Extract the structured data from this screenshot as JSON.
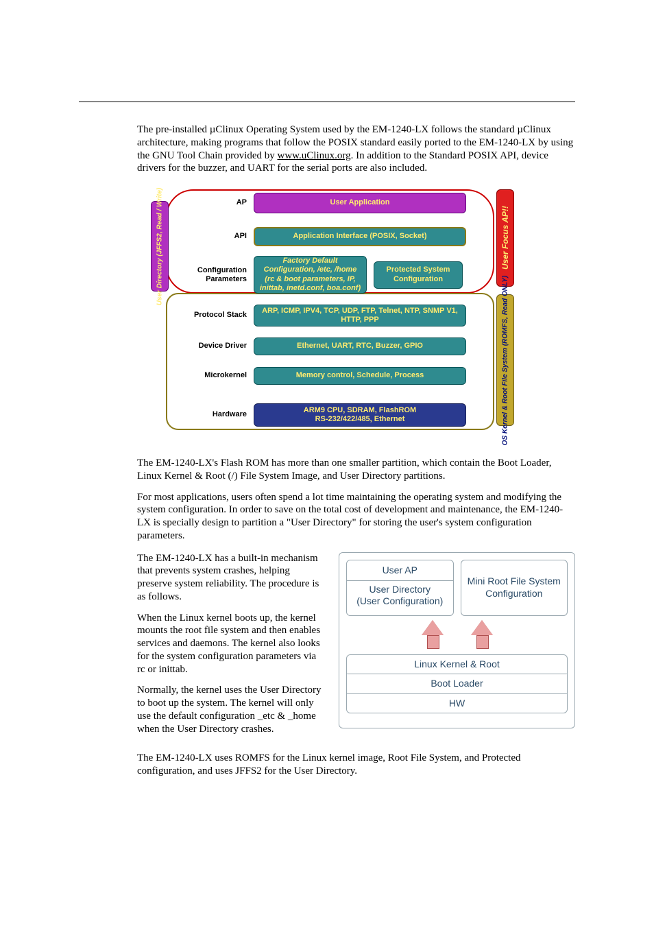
{
  "intro": {
    "p1a": "The pre-installed µClinux Operating System used by the EM-1240-LX follows the standard µClinux architecture, making programs that follow the POSIX standard easily ported to the EM-1240-LX by using the GNU Tool Chain provided by ",
    "p1_link": "www.uClinux.org",
    "p1b": ". In addition to the Standard POSIX API, device drivers for the buzzer, and UART for the serial ports are also included."
  },
  "diagram1": {
    "side_user_dir": "User Directory (JFFS2, Read / Write)",
    "side_user_focus": "User Focus AP!!",
    "side_os_kernel": "OS Kernel & Root File System (ROMFS, Read ONLY)",
    "rows": {
      "ap": {
        "label": "AP",
        "box": "User Application"
      },
      "api": {
        "label": "API",
        "box": "Application Interface (POSIX, Socket)"
      },
      "cfg": {
        "label1": "Configuration",
        "label2": "Parameters",
        "factory_title": "Factory Default",
        "factory_l2": "Configuration, /etc, /home",
        "factory_l3": "(rc & boot parameters, IP, inittab, inetd.conf, boa.conf)",
        "protected_l1": "Protected System",
        "protected_l2": "Configuration"
      },
      "proto": {
        "label": "Protocol Stack",
        "box": "ARP, ICMP, IPV4, TCP, UDP, FTP, Telnet, NTP, SNMP V1, HTTP, PPP"
      },
      "drv": {
        "label": "Device Driver",
        "box": "Ethernet, UART, RTC, Buzzer, GPIO"
      },
      "mk": {
        "label": "Microkernel",
        "box": "Memory control, Schedule, Process"
      },
      "hw": {
        "label": "Hardware",
        "box_l1": "ARM9 CPU, SDRAM, FlashROM",
        "box_l2": "RS-232/422/485, Ethernet"
      }
    }
  },
  "mid": {
    "p2": "The EM-1240-LX's Flash ROM has more than one smaller partition, which contain the Boot Loader, Linux Kernel & Root (/) File System Image, and User Directory partitions.",
    "p3": "For most applications, users often spend a lot time maintaining the operating system and modifying the system configuration. In order to save on the total cost of development and maintenance, the EM-1240-LX is specially design to partition a \"User Directory\" for storing the user's system configuration parameters."
  },
  "twocol": {
    "p4": "The EM-1240-LX has a built-in mechanism that prevents system crashes, helping preserve system reliability. The procedure is as follows.",
    "p5": "When the Linux kernel boots up, the kernel mounts the root file system and then enables services and daemons. The kernel also looks for the system configuration parameters via rc or inittab.",
    "p6": "Normally, the kernel uses the User Directory to boot up the system. The kernel will only use the default configuration _etc & _home when the User Directory crashes."
  },
  "diagram2": {
    "user_ap": "User AP",
    "user_dir_l1": "User Directory",
    "user_dir_l2": "(User Configuration)",
    "mini_root_l1": "Mini Root File System",
    "mini_root_l2": "Configuration",
    "kernel": "Linux Kernel & Root",
    "boot": "Boot Loader",
    "hw": "HW"
  },
  "closing": {
    "p7": "The EM-1240-LX uses ROMFS for the Linux kernel image, Root File System, and Protected configuration, and uses JFFS2 for the User Directory."
  }
}
